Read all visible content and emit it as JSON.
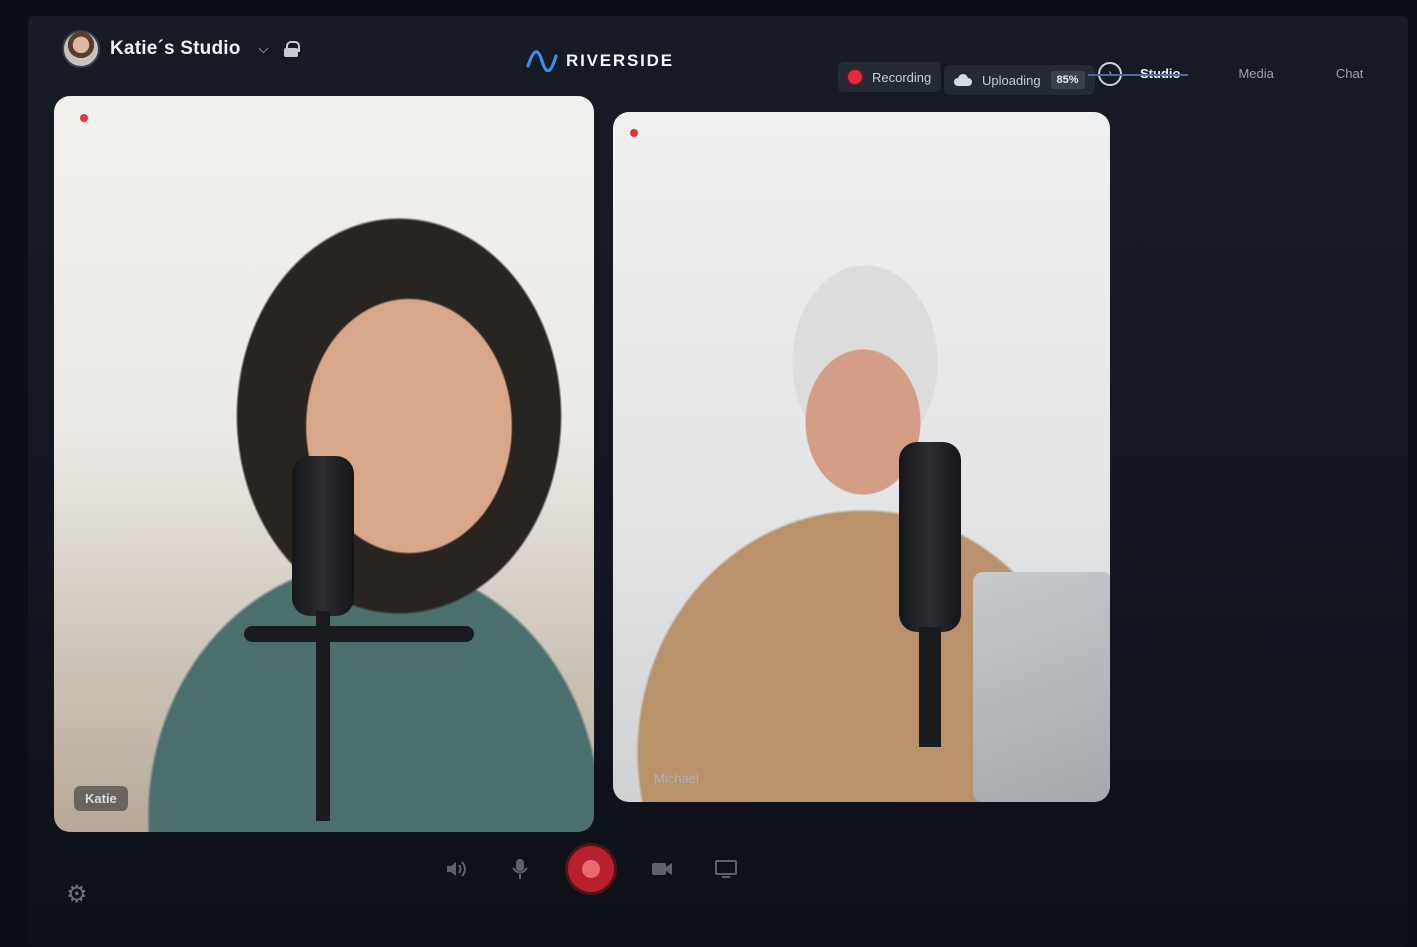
{
  "header": {
    "studio_title": "Katie´s Studio",
    "brand": "RIVERSIDE"
  },
  "status": {
    "recording_label": "Recording",
    "uploading_label": "Uploading",
    "upload_progress": "85%"
  },
  "tabs": [
    {
      "label": "Studio",
      "active": true
    },
    {
      "label": "Media",
      "active": false
    },
    {
      "label": "Chat",
      "active": false
    }
  ],
  "participants": [
    {
      "name": "Katie"
    },
    {
      "name": "Michael"
    }
  ],
  "colors": {
    "accent": "#4c6aa8",
    "record_red": "#e02c3b",
    "background": "#121620"
  },
  "icons": {
    "studio_tab": "play-circle-icon",
    "settings": "gear-icon",
    "speaker": "speaker-icon",
    "mic": "microphone-icon",
    "record": "record-icon",
    "camera": "camera-icon",
    "screen": "screen-share-icon"
  }
}
